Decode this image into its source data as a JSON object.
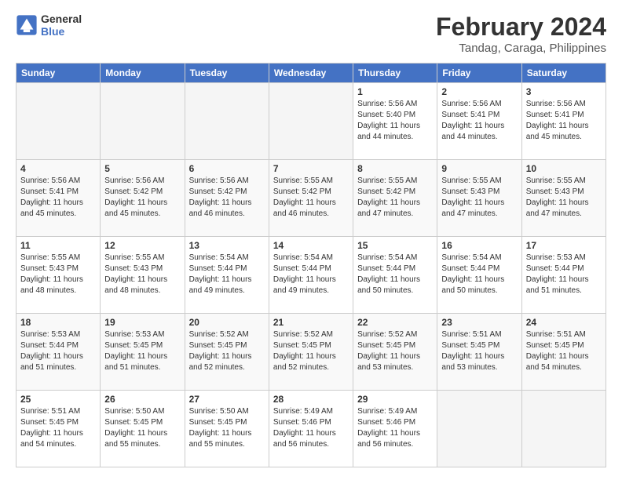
{
  "logo": {
    "text_general": "General",
    "text_blue": "Blue"
  },
  "header": {
    "month_year": "February 2024",
    "location": "Tandag, Caraga, Philippines"
  },
  "weekdays": [
    "Sunday",
    "Monday",
    "Tuesday",
    "Wednesday",
    "Thursday",
    "Friday",
    "Saturday"
  ],
  "weeks": [
    [
      {
        "day": "",
        "info": ""
      },
      {
        "day": "",
        "info": ""
      },
      {
        "day": "",
        "info": ""
      },
      {
        "day": "",
        "info": ""
      },
      {
        "day": "1",
        "info": "Sunrise: 5:56 AM\nSunset: 5:40 PM\nDaylight: 11 hours\nand 44 minutes."
      },
      {
        "day": "2",
        "info": "Sunrise: 5:56 AM\nSunset: 5:41 PM\nDaylight: 11 hours\nand 44 minutes."
      },
      {
        "day": "3",
        "info": "Sunrise: 5:56 AM\nSunset: 5:41 PM\nDaylight: 11 hours\nand 45 minutes."
      }
    ],
    [
      {
        "day": "4",
        "info": "Sunrise: 5:56 AM\nSunset: 5:41 PM\nDaylight: 11 hours\nand 45 minutes."
      },
      {
        "day": "5",
        "info": "Sunrise: 5:56 AM\nSunset: 5:42 PM\nDaylight: 11 hours\nand 45 minutes."
      },
      {
        "day": "6",
        "info": "Sunrise: 5:56 AM\nSunset: 5:42 PM\nDaylight: 11 hours\nand 46 minutes."
      },
      {
        "day": "7",
        "info": "Sunrise: 5:55 AM\nSunset: 5:42 PM\nDaylight: 11 hours\nand 46 minutes."
      },
      {
        "day": "8",
        "info": "Sunrise: 5:55 AM\nSunset: 5:42 PM\nDaylight: 11 hours\nand 47 minutes."
      },
      {
        "day": "9",
        "info": "Sunrise: 5:55 AM\nSunset: 5:43 PM\nDaylight: 11 hours\nand 47 minutes."
      },
      {
        "day": "10",
        "info": "Sunrise: 5:55 AM\nSunset: 5:43 PM\nDaylight: 11 hours\nand 47 minutes."
      }
    ],
    [
      {
        "day": "11",
        "info": "Sunrise: 5:55 AM\nSunset: 5:43 PM\nDaylight: 11 hours\nand 48 minutes."
      },
      {
        "day": "12",
        "info": "Sunrise: 5:55 AM\nSunset: 5:43 PM\nDaylight: 11 hours\nand 48 minutes."
      },
      {
        "day": "13",
        "info": "Sunrise: 5:54 AM\nSunset: 5:44 PM\nDaylight: 11 hours\nand 49 minutes."
      },
      {
        "day": "14",
        "info": "Sunrise: 5:54 AM\nSunset: 5:44 PM\nDaylight: 11 hours\nand 49 minutes."
      },
      {
        "day": "15",
        "info": "Sunrise: 5:54 AM\nSunset: 5:44 PM\nDaylight: 11 hours\nand 50 minutes."
      },
      {
        "day": "16",
        "info": "Sunrise: 5:54 AM\nSunset: 5:44 PM\nDaylight: 11 hours\nand 50 minutes."
      },
      {
        "day": "17",
        "info": "Sunrise: 5:53 AM\nSunset: 5:44 PM\nDaylight: 11 hours\nand 51 minutes."
      }
    ],
    [
      {
        "day": "18",
        "info": "Sunrise: 5:53 AM\nSunset: 5:44 PM\nDaylight: 11 hours\nand 51 minutes."
      },
      {
        "day": "19",
        "info": "Sunrise: 5:53 AM\nSunset: 5:45 PM\nDaylight: 11 hours\nand 51 minutes."
      },
      {
        "day": "20",
        "info": "Sunrise: 5:52 AM\nSunset: 5:45 PM\nDaylight: 11 hours\nand 52 minutes."
      },
      {
        "day": "21",
        "info": "Sunrise: 5:52 AM\nSunset: 5:45 PM\nDaylight: 11 hours\nand 52 minutes."
      },
      {
        "day": "22",
        "info": "Sunrise: 5:52 AM\nSunset: 5:45 PM\nDaylight: 11 hours\nand 53 minutes."
      },
      {
        "day": "23",
        "info": "Sunrise: 5:51 AM\nSunset: 5:45 PM\nDaylight: 11 hours\nand 53 minutes."
      },
      {
        "day": "24",
        "info": "Sunrise: 5:51 AM\nSunset: 5:45 PM\nDaylight: 11 hours\nand 54 minutes."
      }
    ],
    [
      {
        "day": "25",
        "info": "Sunrise: 5:51 AM\nSunset: 5:45 PM\nDaylight: 11 hours\nand 54 minutes."
      },
      {
        "day": "26",
        "info": "Sunrise: 5:50 AM\nSunset: 5:45 PM\nDaylight: 11 hours\nand 55 minutes."
      },
      {
        "day": "27",
        "info": "Sunrise: 5:50 AM\nSunset: 5:45 PM\nDaylight: 11 hours\nand 55 minutes."
      },
      {
        "day": "28",
        "info": "Sunrise: 5:49 AM\nSunset: 5:46 PM\nDaylight: 11 hours\nand 56 minutes."
      },
      {
        "day": "29",
        "info": "Sunrise: 5:49 AM\nSunset: 5:46 PM\nDaylight: 11 hours\nand 56 minutes."
      },
      {
        "day": "",
        "info": ""
      },
      {
        "day": "",
        "info": ""
      }
    ]
  ]
}
